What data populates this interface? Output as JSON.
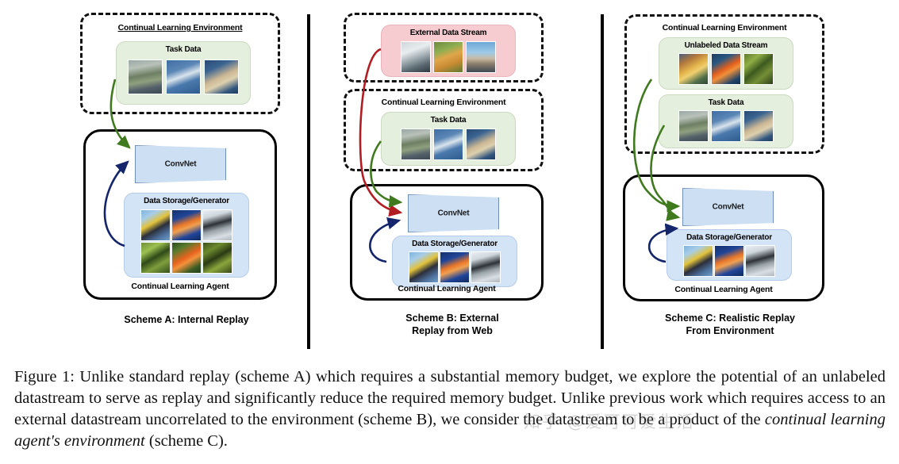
{
  "figure": {
    "caption_prefix": "Figure 1:",
    "caption_part1": " Unlike standard replay (scheme A) which requires a substantial memory budget, we explore the potential of an unlabeled datastream to serve as replay and significantly reduce the required memory budget. Unlike previous work which requires access to an external datastream uncorrelated to the environment (scheme B), we consider the datastream to be a product of the ",
    "caption_italic": "continual learning agent's environment",
    "caption_part2": " (scheme C).",
    "watermark": "知乎 @爱可可爱生活"
  },
  "panels": [
    {
      "id": "scheme-a",
      "caption": "Scheme A: Internal Replay",
      "environment": {
        "title": "Continual Learning Environment",
        "groups": [
          {
            "id": "task-data",
            "title": "Task Data",
            "color": "#e4efdd",
            "thumbs": [
              "goose-photo",
              "gull-photo",
              "duck-photo"
            ]
          }
        ]
      },
      "agent": {
        "label": "Continual Learning Agent",
        "network": {
          "label": "ConvNet",
          "color": "#cddff2"
        },
        "storage": {
          "title": "Data Storage/Generator",
          "color": "#d4e4f7",
          "thumbs": [
            "kingfisher-photo",
            "jellyfish-photo",
            "penguin-photo",
            "beetle-photo",
            "orangefish-photo",
            "frog-photo"
          ]
        }
      },
      "arrows": [
        {
          "id": "task-to-convnet",
          "color": "#3f7a1e"
        },
        {
          "id": "storage-to-convnet",
          "color": "#14256b"
        }
      ]
    },
    {
      "id": "scheme-b",
      "caption_line1": "Scheme B: External",
      "caption_line2": "Replay from Web",
      "external": {
        "group": {
          "id": "external-data-stream",
          "title": "External Data Stream",
          "color": "#f6ccd0",
          "thumbs": [
            "truck-photo",
            "dog-photo",
            "harbor-photo"
          ]
        }
      },
      "environment": {
        "title": "Continual Learning Environment",
        "groups": [
          {
            "id": "task-data",
            "title": "Task Data",
            "color": "#e4efdd",
            "thumbs": [
              "goose-photo",
              "gull-photo",
              "duck-photo"
            ]
          }
        ]
      },
      "agent": {
        "label": "Continual Learning Agent",
        "network": {
          "label": "ConvNet",
          "color": "#cddff2"
        },
        "storage": {
          "title": "Data Storage/Generator",
          "color": "#d4e4f7",
          "thumbs": [
            "kingfisher-photo",
            "jellyfish-photo",
            "penguin-photo"
          ]
        }
      },
      "arrows": [
        {
          "id": "external-to-convnet",
          "color": "#b11d22"
        },
        {
          "id": "task-to-convnet",
          "color": "#3f7a1e"
        },
        {
          "id": "storage-to-convnet",
          "color": "#14256b"
        }
      ]
    },
    {
      "id": "scheme-c",
      "caption_line1": "Scheme C: Realistic Replay",
      "caption_line2": "From Environment",
      "environment": {
        "title": "Continual Learning Environment",
        "groups": [
          {
            "id": "unlabeled-data-stream",
            "title": "Unlabeled Data Stream",
            "color": "#e4efdd",
            "thumbs": [
              "fishyellow-photo",
              "goldfish-photo",
              "leaf-photo"
            ]
          },
          {
            "id": "task-data",
            "title": "Task Data",
            "color": "#e4efdd",
            "thumbs": [
              "goose-photo",
              "gull-photo",
              "duck-photo"
            ]
          }
        ]
      },
      "agent": {
        "label": "Continual Learning Agent",
        "network": {
          "label": "ConvNet",
          "color": "#cddff2"
        },
        "storage": {
          "title": "Data Storage/Generator",
          "color": "#d4e4f7",
          "thumbs": [
            "kingfisher-photo",
            "jellyfish-photo",
            "penguin-photo"
          ]
        }
      },
      "arrows": [
        {
          "id": "unlabeled-to-convnet",
          "color": "#3f7a1e"
        },
        {
          "id": "task-to-convnet",
          "color": "#3f7a1e"
        },
        {
          "id": "storage-to-convnet",
          "color": "#14256b"
        }
      ]
    }
  ]
}
